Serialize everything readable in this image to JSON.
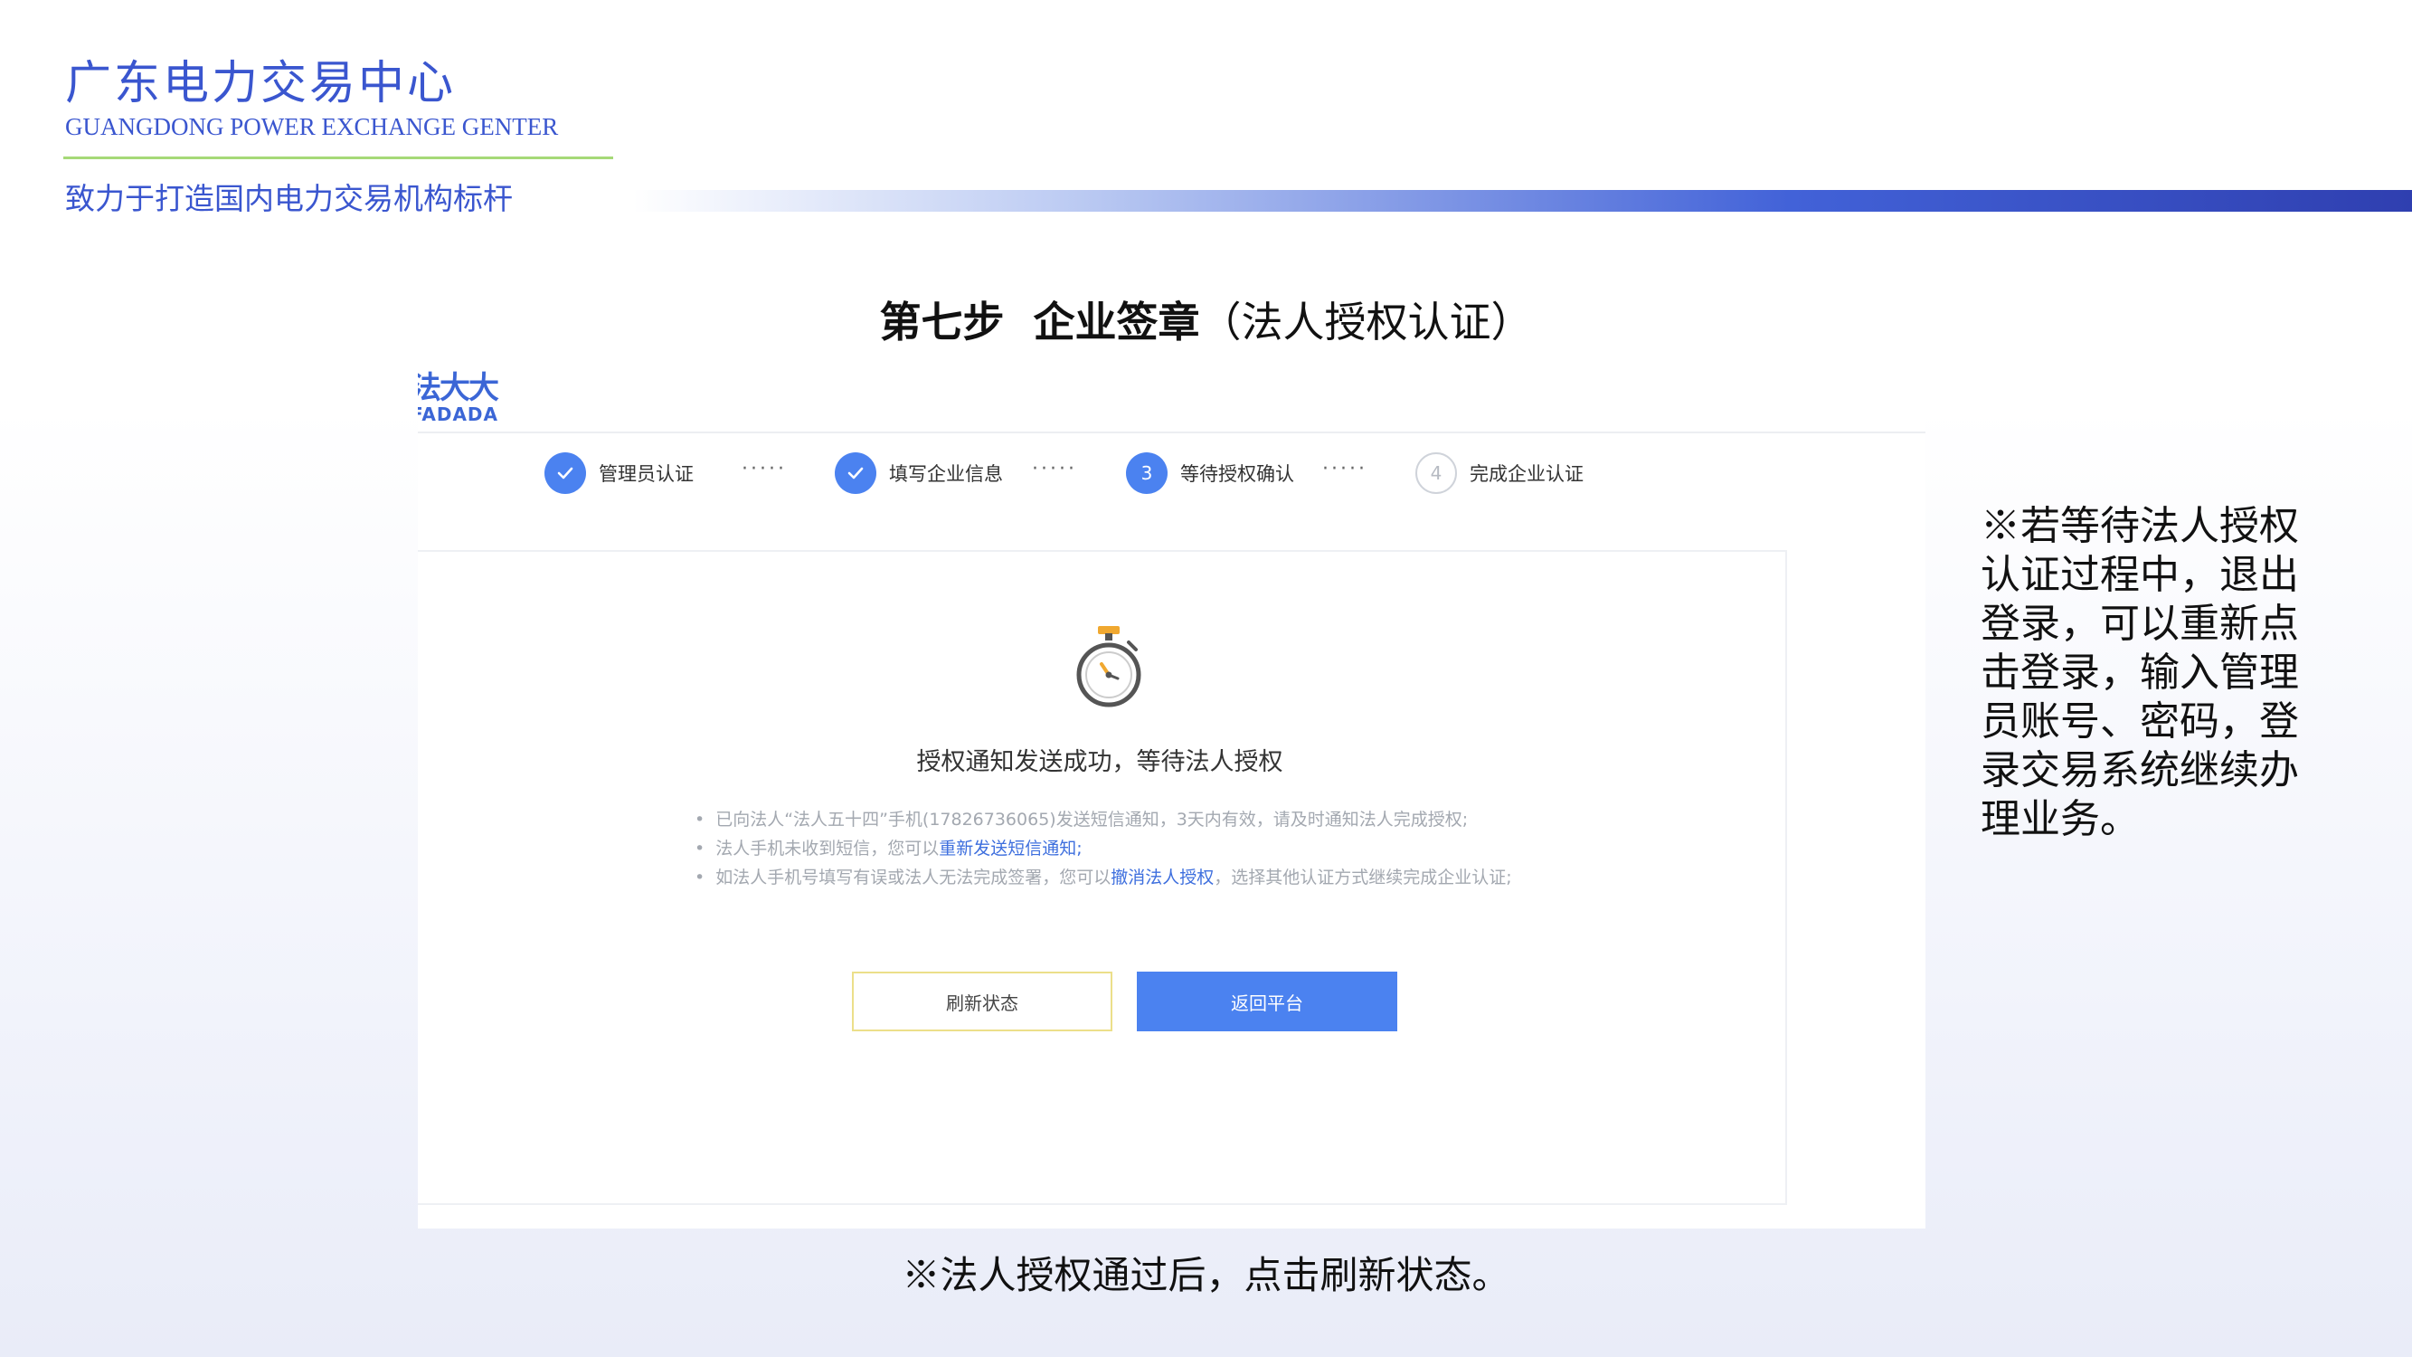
{
  "header": {
    "title": "广东电力交易中心",
    "subtitle": "GUANGDONG POWER EXCHANGE GENTER",
    "slogan": "致力于打造国内电力交易机构标杆"
  },
  "step_title": {
    "main": "第七步  企业签章",
    "sub": "（法人授权认证）"
  },
  "app": {
    "logo_line1": "法大大",
    "logo_line2": "FADADA",
    "steps": [
      {
        "label": "管理员认证",
        "state": "done",
        "number": ""
      },
      {
        "label": "填写企业信息",
        "state": "done",
        "number": ""
      },
      {
        "label": "等待授权确认",
        "state": "active",
        "number": "3"
      },
      {
        "label": "完成企业认证",
        "state": "todo",
        "number": "4"
      }
    ],
    "step_separator": "·····",
    "card": {
      "title": "授权通知发送成功，等待法人授权",
      "note1": "已向法人“法人五十四”手机(17826736065)发送短信通知，3天内有效，请及时通知法人完成授权;",
      "note2_prefix": "法人手机未收到短信，您可以",
      "note2_link": "重新发送短信通知",
      "note2_suffix": ";",
      "note3_prefix": "如法人手机号填写有误或法人无法完成签署，您可以",
      "note3_link": "撤消法人授权",
      "note3_suffix": "，选择其他认证方式继续完成企业认证;",
      "refresh_button": "刷新状态",
      "return_button": "返回平台"
    },
    "colors": {
      "primary": "#4b82f0",
      "link": "#3e6fde",
      "refresh_border": "#ecdf8a"
    }
  },
  "right_note": "※若等待法人授权认证过程中，退出登录，可以重新点击登录，输入管理员账号、密码，登录交易系统继续办理业务。",
  "bottom_note": "※法人授权通过后，点击刷新状态。",
  "icons": {
    "check": "check-icon",
    "timer": "stopwatch-icon"
  }
}
